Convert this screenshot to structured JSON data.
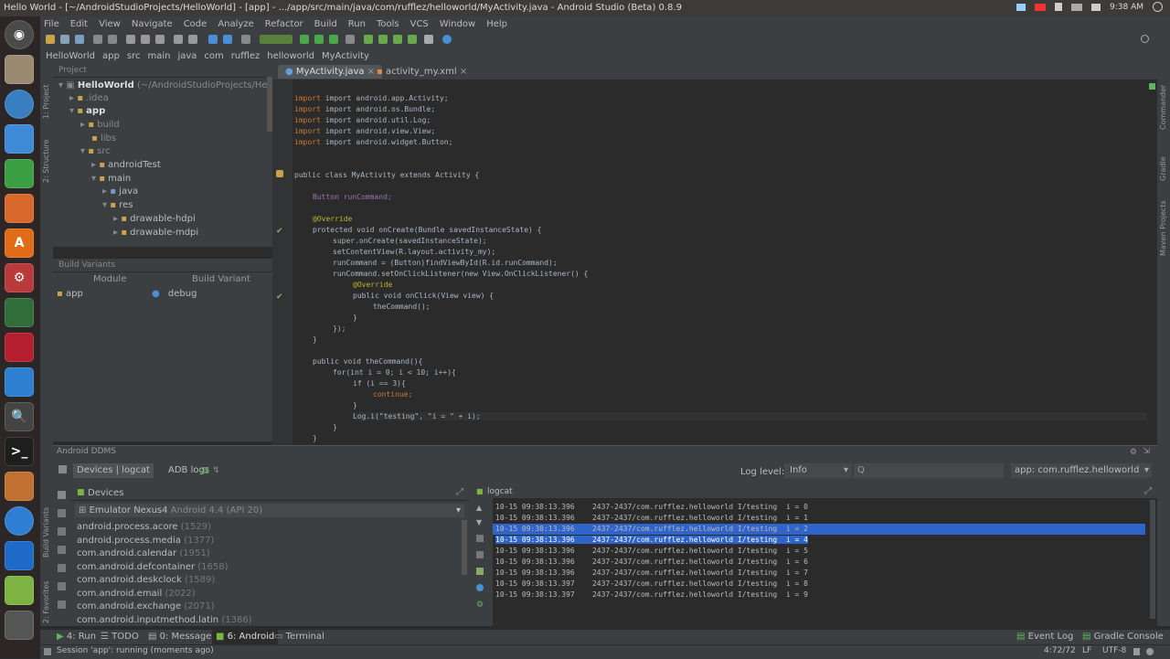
{
  "window": {
    "title": "Hello World - [~/AndroidStudioProjects/HelloWorld] - [app] - .../app/src/main/java/com/rufflez/helloworld/MyActivity.java - Android Studio (Beta) 0.8.9",
    "clock": "9:38 AM"
  },
  "menu": [
    "File",
    "Edit",
    "View",
    "Navigate",
    "Code",
    "Analyze",
    "Refactor",
    "Build",
    "Run",
    "Tools",
    "VCS",
    "Window",
    "Help"
  ],
  "breadcrumb": [
    "HelloWorld",
    "app",
    "src",
    "main",
    "java",
    "com",
    "rufflez",
    "helloworld",
    "MyActivity"
  ],
  "left_stripe": {
    "project": "1: Project",
    "structure": "2: Structure",
    "build_variants": "Build Variants",
    "favorites": "2: Favorites"
  },
  "right_stripe": {
    "commander": "Commander",
    "gradle": "Gradle",
    "maven": "Maven Projects"
  },
  "project_panel": {
    "header": "Project",
    "tree": [
      {
        "label": "HelloWorld",
        "suffix": " (~/AndroidStudioProjects/HelloWorld)"
      },
      {
        "label": ".idea"
      },
      {
        "label": "app"
      },
      {
        "label": "build"
      },
      {
        "label": "libs"
      },
      {
        "label": "src"
      },
      {
        "label": "androidTest"
      },
      {
        "label": "main"
      },
      {
        "label": "java"
      },
      {
        "label": "res"
      },
      {
        "label": "drawable-hdpi"
      },
      {
        "label": "drawable-mdpi"
      }
    ]
  },
  "build_variants": {
    "header": "Build Variants",
    "col_module": "Module",
    "col_variant": "Build Variant",
    "module": "app",
    "variant": "debug"
  },
  "editor_tabs": [
    {
      "label": "MyActivity.java"
    },
    {
      "label": "activity_my.xml"
    }
  ],
  "code": [
    [
      "import android.app.Activity;"
    ],
    [
      "import android.os.Bundle;"
    ],
    [
      "import android.util.Log;"
    ],
    [
      "import android.view.View;"
    ],
    [
      "import android.widget.Button;"
    ],
    [
      "public class MyActivity extends Activity {"
    ],
    [
      "Button runCommand;"
    ],
    [
      "@Override"
    ],
    [
      "protected void onCreate(Bundle savedInstanceState) {"
    ],
    [
      "super.onCreate(savedInstanceState);"
    ],
    [
      "setContentView(R.layout.activity_my);"
    ],
    [
      "runCommand = (Button)findViewById(R.id.runCommand);"
    ],
    [
      "runCommand.setOnClickListener(new View.OnClickListener() {"
    ],
    [
      "@Override"
    ],
    [
      "public void onClick(View view) {"
    ],
    [
      "theCommand();"
    ],
    [
      "}"
    ],
    [
      "});"
    ],
    [
      "}"
    ],
    [
      "public void theCommand(){"
    ],
    [
      "for(int i = 0; i < 10; i++){"
    ],
    [
      "if (i == 3){"
    ],
    [
      "continue;"
    ],
    [
      "}"
    ],
    [
      "Log.i(\"testing\", \"i = \" + i);"
    ],
    [
      "}"
    ],
    [
      "}"
    ]
  ],
  "ddms": {
    "header": "Android DDMS",
    "tab_devices": "Devices | logcat",
    "tab_adb": "ADB logs",
    "log_level_label": "Log level:",
    "log_level_value": "Info",
    "search_placeholder": "Q",
    "app_filter": "app: com.rufflez.helloworld",
    "devices_header": "Devices",
    "logcat_header": "logcat",
    "emulator": "Emulator Nexus4",
    "emulator_suffix": " Android 4.4 (API 20)",
    "processes": [
      {
        "name": "android.process.acore",
        "pid": "(1529)"
      },
      {
        "name": "android.process.media",
        "pid": "(1377)"
      },
      {
        "name": "com.android.calendar",
        "pid": "(1951)"
      },
      {
        "name": "com.android.defcontainer",
        "pid": "(1658)"
      },
      {
        "name": "com.android.deskclock",
        "pid": "(1589)"
      },
      {
        "name": "com.android.email",
        "pid": "(2022)"
      },
      {
        "name": "com.android.exchange",
        "pid": "(2071)"
      },
      {
        "name": "com.android.inputmethod.latin",
        "pid": "(1386)"
      }
    ],
    "log_lines": [
      "10-15 09:38:13.396    2437-2437/com.rufflez.helloworld I/testing  i = 0",
      "10-15 09:38:13.396    2437-2437/com.rufflez.helloworld I/testing  i = 1",
      "10-15 09:38:13.396    2437-2437/com.rufflez.helloworld I/testing  i = 2",
      "10-15 09:38:13.396    2437-2437/com.rufflez.helloworld I/testing  i = 4",
      "10-15 09:38:13.396    2437-2437/com.rufflez.helloworld I/testing  i = 5",
      "10-15 09:38:13.396    2437-2437/com.rufflez.helloworld I/testing  i = 6",
      "10-15 09:38:13.396    2437-2437/com.rufflez.helloworld I/testing  i = 7",
      "10-15 09:38:13.397    2437-2437/com.rufflez.helloworld I/testing  i = 8",
      "10-15 09:38:13.397    2437-2437/com.rufflez.helloworld I/testing  i = 9"
    ]
  },
  "bottom_tabs": [
    "4: Run",
    "TODO",
    "0: Messages",
    "6: Android",
    "Terminal"
  ],
  "bottom_right_tabs": [
    "Event Log",
    "Gradle Console"
  ],
  "status": {
    "message": "Session 'app': running (moments ago)",
    "position": "4:72/72",
    "line_sep": "LF",
    "encoding": "UTF-8"
  },
  "colors": {
    "accent_selection": "#2f65ca",
    "keyword": "#cc7832",
    "annotation": "#bbb529",
    "field": "#9876aa",
    "string": "#6a8759",
    "method": "#ffc66d"
  }
}
